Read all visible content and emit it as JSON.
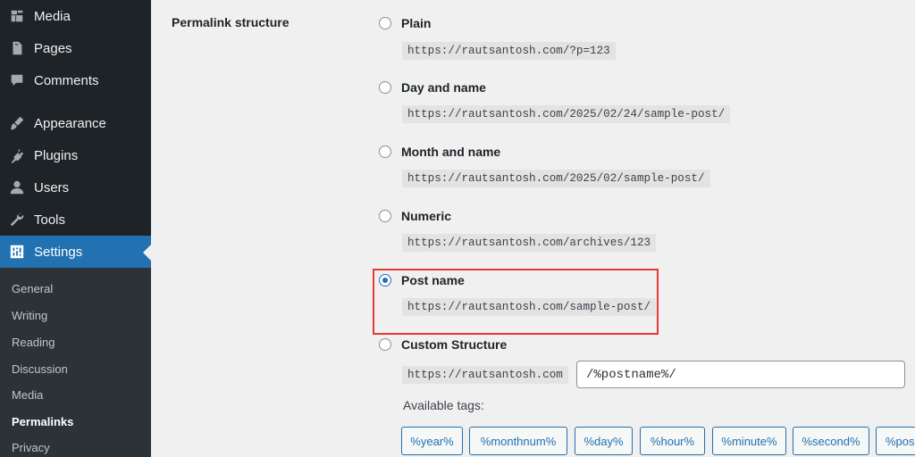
{
  "sidebar": {
    "items": [
      {
        "label": "Media",
        "icon": "media-icon"
      },
      {
        "label": "Pages",
        "icon": "pages-icon"
      },
      {
        "label": "Comments",
        "icon": "comments-icon"
      },
      {
        "label": "Appearance",
        "icon": "appearance-brush-icon"
      },
      {
        "label": "Plugins",
        "icon": "plugins-icon"
      },
      {
        "label": "Users",
        "icon": "users-icon"
      },
      {
        "label": "Tools",
        "icon": "tools-wrench-icon"
      },
      {
        "label": "Settings",
        "icon": "settings-sliders-icon",
        "active": true
      }
    ],
    "submenu": [
      "General",
      "Writing",
      "Reading",
      "Discussion",
      "Media",
      "Permalinks",
      "Privacy"
    ],
    "submenu_current": "Permalinks"
  },
  "permalink": {
    "field_label": "Permalink structure",
    "options": [
      {
        "label": "Plain",
        "example": "https://rautsantosh.com/?p=123",
        "checked": false
      },
      {
        "label": "Day and name",
        "example": "https://rautsantosh.com/2025/02/24/sample-post/",
        "checked": false
      },
      {
        "label": "Month and name",
        "example": "https://rautsantosh.com/2025/02/sample-post/",
        "checked": false
      },
      {
        "label": "Numeric",
        "example": "https://rautsantosh.com/archives/123",
        "checked": false
      },
      {
        "label": "Post name",
        "example": "https://rautsantosh.com/sample-post/",
        "checked": true
      },
      {
        "label": "Custom Structure",
        "checked": false
      }
    ],
    "custom": {
      "base_url": "https://rautsantosh.com",
      "value": "/%postname%/"
    },
    "available_tags_label": "Available tags:",
    "tags": [
      "%year%",
      "%monthnum%",
      "%day%",
      "%hour%",
      "%minute%",
      "%second%",
      "%pos"
    ]
  },
  "colors": {
    "sidebar_bg": "#1d2327",
    "accent": "#2271b1",
    "highlight_border": "#e53935"
  }
}
